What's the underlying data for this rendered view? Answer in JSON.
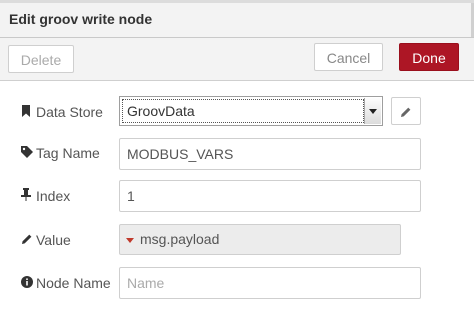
{
  "dialog": {
    "title": "Edit groov write node"
  },
  "toolbar": {
    "delete_label": "Delete",
    "cancel_label": "Cancel",
    "done_label": "Done",
    "done_color": "#ad1625"
  },
  "form": {
    "data_store": {
      "label": "Data Store",
      "icon": "bookmark-icon",
      "selected": "GroovData",
      "edit_icon": "pencil-icon"
    },
    "tag_name": {
      "label": "Tag Name",
      "icon": "tag-icon",
      "value": "MODBUS_VARS"
    },
    "index": {
      "label": "Index",
      "icon": "thumbtack-icon",
      "value": "1"
    },
    "value": {
      "label": "Value",
      "icon": "pencil-icon",
      "type_marker": "caret-down-icon",
      "value": "msg.payload"
    },
    "node_name": {
      "label": "Node Name",
      "icon": "info-circle-icon",
      "value": "",
      "placeholder": "Name"
    }
  }
}
